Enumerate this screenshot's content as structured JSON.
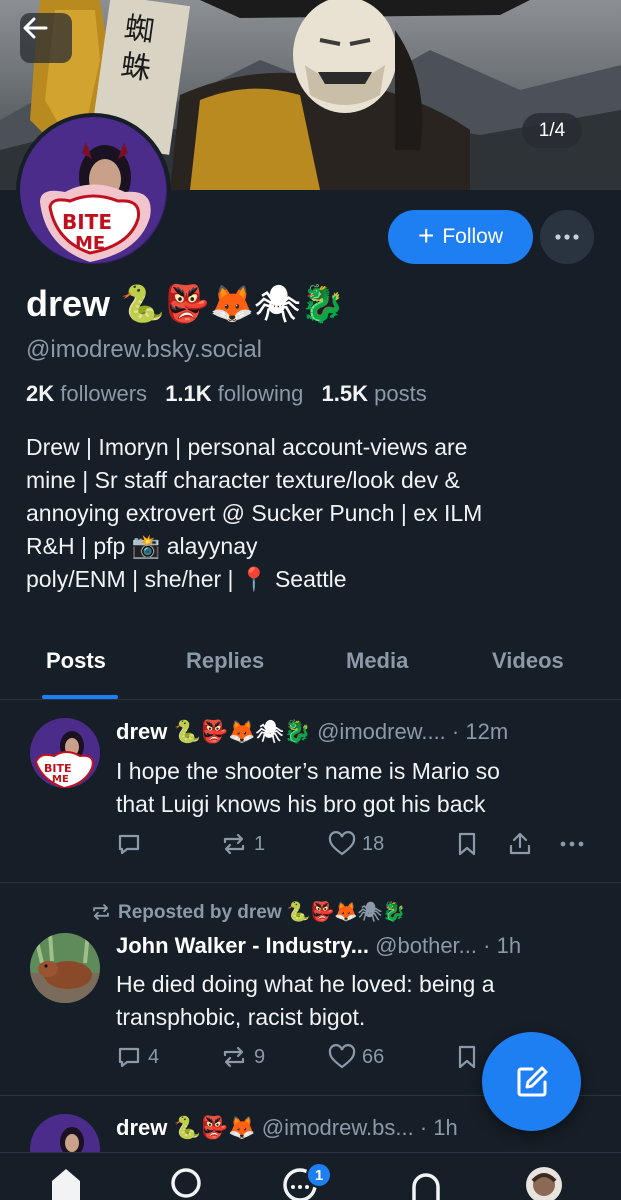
{
  "header": {
    "back_icon": "arrow-left-icon",
    "image_counter": "1/4"
  },
  "profile": {
    "display_name": "drew 🐍👺🦊🕷🐉",
    "handle": "@imodrew.bsky.social",
    "follow_label": "Follow",
    "stats": {
      "followers_count": "2K",
      "followers_label": "followers",
      "following_count": "1.1K",
      "following_label": "following",
      "posts_count": "1.5K",
      "posts_label": "posts"
    },
    "bio_lines": [
      "Drew | Imoryn | personal account-views are",
      "mine | Sr staff character texture/look dev &",
      "annoying extrovert @ Sucker Punch | ex ILM",
      "R&H | pfp 📸 alayynay",
      "poly/ENM | she/her | 📍 Seattle"
    ],
    "avatar_text": "BITE ME"
  },
  "tabs": [
    {
      "label": "Posts",
      "active": true
    },
    {
      "label": "Replies",
      "active": false
    },
    {
      "label": "Media",
      "active": false
    },
    {
      "label": "Videos",
      "active": false
    }
  ],
  "posts": [
    {
      "author": "drew 🐍👺🦊🕷🐉",
      "handle": "@imodrew....",
      "time": "· 12m",
      "text_lines": [
        "I hope the shooter’s name is Mario so",
        "that Luigi knows his bro got his back"
      ],
      "replies": "",
      "reposts": "1",
      "likes": "18"
    },
    {
      "repost_label": "Reposted by drew 🐍👺🦊🕷🐉",
      "author": "John Walker - Industry...",
      "handle": "@bother...",
      "time": "· 1h",
      "text_lines": [
        "He died doing what he loved: being a",
        "transphobic, racist bigot."
      ],
      "replies": "4",
      "reposts": "9",
      "likes": "66"
    },
    {
      "author": "drew 🐍👺🦊",
      "handle": "@imodrew.bs...",
      "time": "· 1h"
    }
  ],
  "nav": {
    "chat_badge": "1"
  },
  "colors": {
    "background": "#161e27",
    "accent": "#1d7ff2",
    "muted_text": "#8b99a8",
    "divider": "#2a3440"
  }
}
